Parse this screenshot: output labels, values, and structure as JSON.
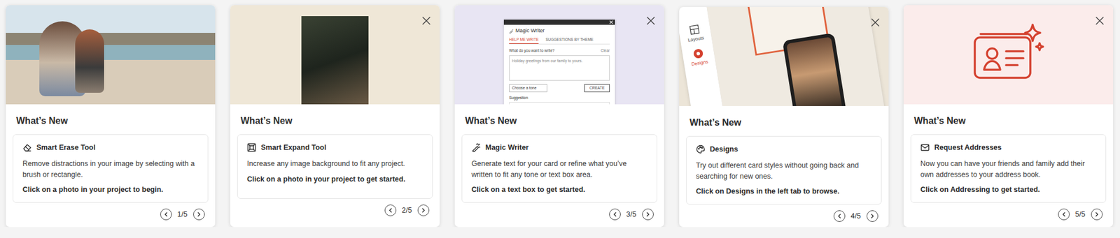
{
  "cards": [
    {
      "media": {
        "kind": "photo"
      },
      "close_button": false,
      "heading": "What’s New",
      "feature": "Smart Erase Tool",
      "description": "Remove distractions in your image by selecting with a brush or rectangle.",
      "cta": "Click on a photo in your project to begin.",
      "pager": "1/5"
    },
    {
      "media": {
        "kind": "portrait"
      },
      "close_button": true,
      "heading": "What’s New",
      "feature": "Smart Expand Tool",
      "description": "Increase any image background to fit any project.",
      "cta": "Click on a photo in your project to get started.",
      "pager": "2/5"
    },
    {
      "media": {
        "kind": "app",
        "window": {
          "title": "Magic Writer",
          "tabs": [
            {
              "label": "HELP ME WRITE",
              "selected": true
            },
            {
              "label": "SUGGESTIONS BY THEME",
              "selected": false
            }
          ],
          "prompt_label": "What do you want to write?",
          "clear": "Clear",
          "text": "Holiday greetings from our family to yours.",
          "tone": "Choose a tone",
          "button": "CREATE",
          "suggestion": "Suggestion"
        }
      },
      "close_button": true,
      "heading": "What’s New",
      "feature": "Magic Writer",
      "description": "Generate text for your card or refine what you’ve written to fit any tone or text box area.",
      "cta": "Click on a text box to get started.",
      "pager": "3/5"
    },
    {
      "media": {
        "kind": "designs",
        "sidebar": [
          {
            "label": "Layouts",
            "selected": false
          },
          {
            "label": "Designs",
            "selected": true
          }
        ]
      },
      "close_button": true,
      "heading": "What’s New",
      "feature": "Designs",
      "description": "Try out different card styles without going back and searching for new ones.",
      "cta": "Click on Designs in the left tab to browse.",
      "pager": "4/5"
    },
    {
      "media": {
        "kind": "icon"
      },
      "close_button": true,
      "heading": "What’s New",
      "feature": "Request Addresses",
      "description": "Now you can have your friends and family add their own addresses to your address book.",
      "cta": "Click on Addressing to get started.",
      "pager": "5/5"
    }
  ]
}
